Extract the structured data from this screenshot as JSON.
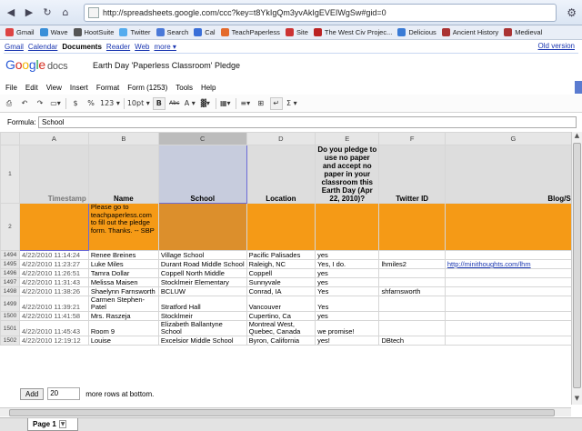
{
  "browser": {
    "url": "http://spreadsheets.google.com/ccc?key=t8YkIgQm3yvAkIgEVEIWgSw#gid=0",
    "back_icon": "back-arrow-icon",
    "forward_icon": "forward-arrow-icon",
    "reload_icon": "reload-icon",
    "home_icon": "home-icon"
  },
  "bookmarks": [
    {
      "label": "Gmail",
      "color": "#d44"
    },
    {
      "label": "Wave",
      "color": "#3a8fd8"
    },
    {
      "label": "HootSuite",
      "color": "#555"
    },
    {
      "label": "Twitter",
      "color": "#55acee"
    },
    {
      "label": "Search",
      "color": "#4a79d8"
    },
    {
      "label": "Cal",
      "color": "#3a6fd8"
    },
    {
      "label": "TeachPaperless",
      "color": "#e46b2c"
    },
    {
      "label": "Site",
      "color": "#c33"
    },
    {
      "label": "The West Civ Projec...",
      "color": "#b22"
    },
    {
      "label": "Delicious",
      "color": "#3a7bd5"
    },
    {
      "label": "Ancient History",
      "color": "#a33"
    },
    {
      "label": "Medieval",
      "color": "#a33"
    }
  ],
  "gbar": {
    "links": [
      "Gmail",
      "Calendar",
      "Documents",
      "Reader",
      "Web",
      "more ▾"
    ],
    "old_version": "Old version"
  },
  "docs": {
    "logo_google": "Google",
    "logo_docs": "docs",
    "title": "Earth Day 'Paperless Classroom' Pledge"
  },
  "menu": [
    "File",
    "Edit",
    "View",
    "Insert",
    "Format",
    "Form (1253)",
    "Tools",
    "Help"
  ],
  "toolbar": {
    "currency": "$",
    "percent": "%",
    "numfmt": "123 ▾",
    "fontsize": "10pt ▾",
    "bold": "B",
    "strike": "Abc",
    "textcolor": "A ▾",
    "sum": "Σ ▾"
  },
  "formula": {
    "label": "Formula:",
    "value": "School"
  },
  "columns": [
    "A",
    "B",
    "C",
    "D",
    "E",
    "F",
    "G"
  ],
  "header_row": {
    "num": "1",
    "cells": [
      "Timestamp",
      "Name",
      "School",
      "Location",
      "Do you pledge to use no paper and accept no paper in your classroom this Earth Day (Apr 22, 2010)?",
      "Twitter ID",
      "Blog/Site"
    ]
  },
  "note_row": {
    "num": "2",
    "text": "Please go to teachpaperless.com to fill out the pledge form. Thanks. -- SBP"
  },
  "rows": [
    {
      "num": "1494",
      "cells": [
        "4/22/2010 11:14:24",
        "Renee Breines",
        "Village School",
        "Pacific Palisades",
        "yes",
        "",
        ""
      ]
    },
    {
      "num": "1495",
      "cells": [
        "4/22/2010 11:23:27",
        "Luke Miles",
        "Durant Road Middle School",
        "Raleigh, NC",
        "Yes, I do.",
        "lhmiles2",
        "http://minithoughts.com/lhm"
      ]
    },
    {
      "num": "1496",
      "cells": [
        "4/22/2010 11:26:51",
        "Tamra Dollar",
        "Coppell North Middle",
        "Coppell",
        "yes",
        "",
        ""
      ]
    },
    {
      "num": "1497",
      "cells": [
        "4/22/2010 11:31:43",
        "Melissa Maisen",
        "Stocklmeir Elementary",
        "Sunnyvale",
        "yes",
        "",
        ""
      ]
    },
    {
      "num": "1498",
      "cells": [
        "4/22/2010 11:38:26",
        "Shaelynn Farnsworth",
        "BCLUW",
        "Conrad, IA",
        "Yes",
        "shfarnsworth",
        ""
      ]
    },
    {
      "num": "1499",
      "cells": [
        "4/22/2010 11:39:21",
        "Carmen Stephen-Patel",
        "Stratford Hall",
        "Vancouver",
        "Yes",
        "",
        ""
      ]
    },
    {
      "num": "1500",
      "cells": [
        "4/22/2010 11:41:58",
        "Mrs. Raszeja",
        "Stocklmeir",
        "Cupertino, Ca",
        "yes",
        "",
        ""
      ]
    },
    {
      "num": "1501",
      "cells": [
        "4/22/2010 11:45:43",
        "Room 9",
        "Elizabeth Ballantyne School",
        "Montreal West, Quebec, Canada",
        "we promise!",
        "",
        ""
      ]
    },
    {
      "num": "1502",
      "cells": [
        "4/22/2010 12:19:12",
        "Louise",
        "Excelsior Middle School",
        "Byron, California",
        "yes!",
        "DBtech",
        ""
      ]
    }
  ],
  "bottom": {
    "add_label": "Add",
    "add_count": "20",
    "after_text": "more rows at bottom."
  },
  "sheet_tab": "Page 1"
}
